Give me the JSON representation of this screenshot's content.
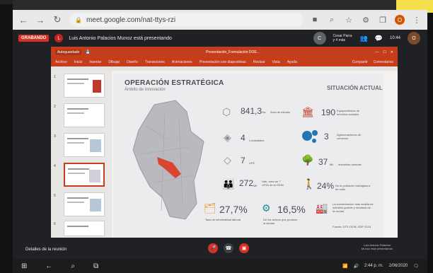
{
  "browser": {
    "url": "meet.google.com/nat-ttys-rzi",
    "profile_initial": "O"
  },
  "meet": {
    "recording_label": "GRABANDO",
    "presenter_initial": "L",
    "presenting_text": "Luis Antonio Palacios Munoz está presentando",
    "participant_name": "Cesar Parra y 4 más",
    "clock_time": "10:44",
    "meeting_details_label": "Detalles de la reunión",
    "present_note": "Luis Antonio Palacios Munoz está presentando"
  },
  "ppt": {
    "autosave_label": "Autoguardado",
    "doc_title": "Presentación_Formulación DOE...",
    "menu_items": [
      "Archivo",
      "Inicio",
      "Insertar",
      "Dibujar",
      "Diseño",
      "Transiciones",
      "Animaciones",
      "Presentación con diapositivas",
      "Revisar",
      "Vista",
      "Ayuda"
    ],
    "share_label": "Compartir",
    "comments_label": "Comentarios"
  },
  "slide": {
    "title": "OPERACIÓN ESTRATÉGICA",
    "subtitle": "Ámbito de Innovación",
    "situacion_label": "SITUACIÓN ACTUAL",
    "stats": {
      "area_num": "841,3",
      "area_unit": "Ha.",
      "area_label": "Área de estudio",
      "localidades_num": "4",
      "localidades_label": "Localidades",
      "upz_num": "7",
      "upz_label": "UPZ",
      "mil_num": "272",
      "mil_unit": "Mil",
      "mil_label": "Hab. área de 7 UPZs de la OEIN",
      "equip_num": "190",
      "equip_label": "Equipamientos de servicios sociales",
      "aglom_num": "3",
      "aglom_label": "Aglomeraciones de comercio",
      "ind_num": "37",
      "ind_unit": "Mil",
      "ind_label": "Industrias urbanas",
      "pobl_num": "24%",
      "pobl_label": "De la población trabajadora de calle",
      "informal_num": "27,7%",
      "informal_label": "Tasa de informalidad laboral",
      "activos_num": "16,5%",
      "activos_label": "De los activos que produce la ciudad",
      "conc_label": "La concentración más amplia de industria grande y mediana de la ciudad",
      "source": "Fuente: DTS OEIN, SDP 2018"
    }
  },
  "taskbar": {
    "time": "2:44 p. m.",
    "date": "2/06/2020"
  },
  "colors": {
    "ppt_red": "#c43e1c",
    "meet_dark": "#202124",
    "record_red": "#d93025"
  }
}
